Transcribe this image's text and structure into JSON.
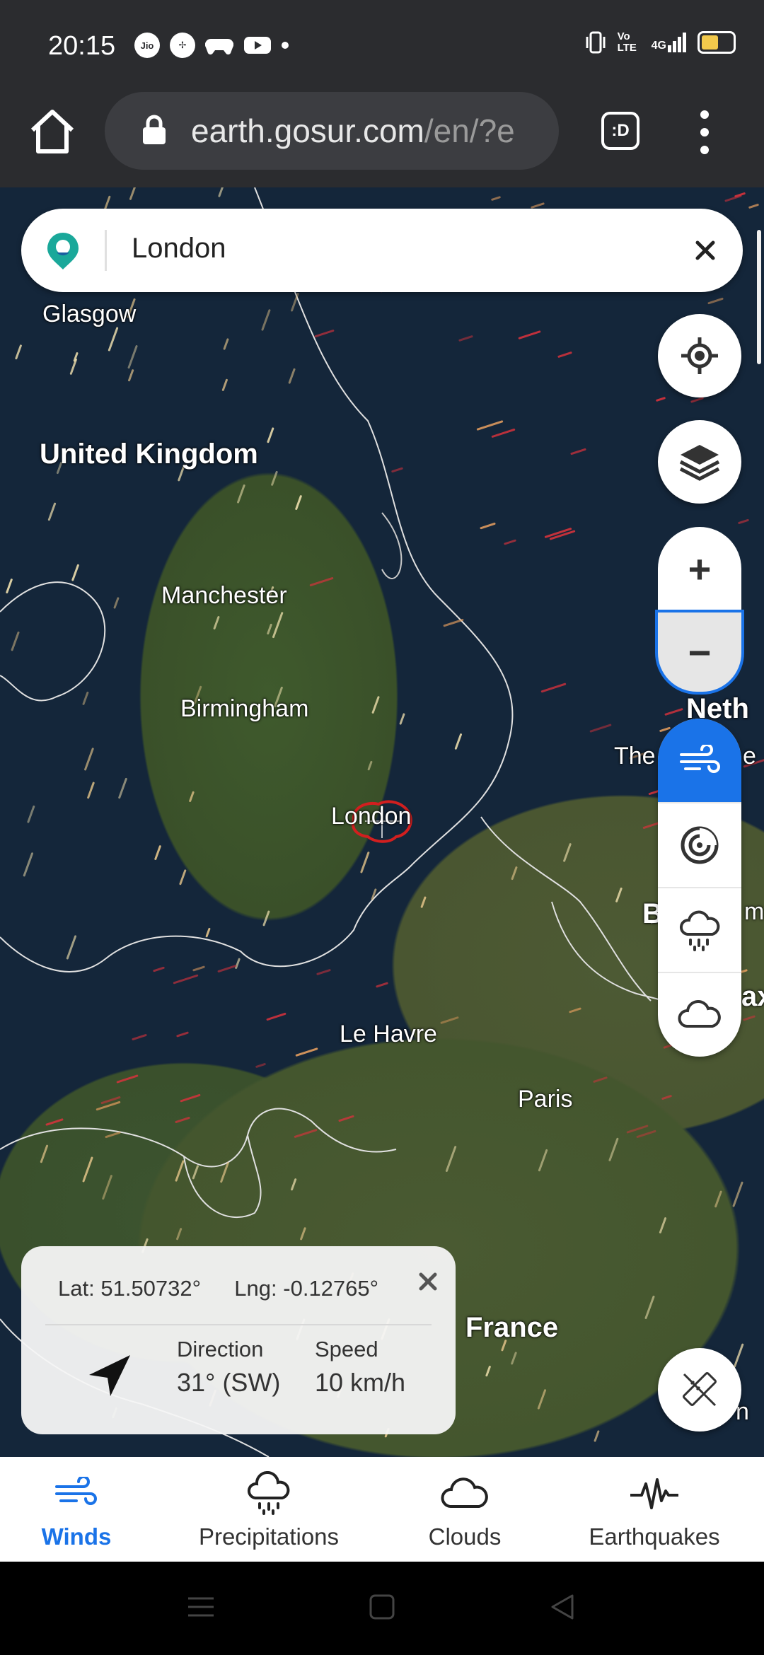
{
  "status_bar": {
    "time": "20:15",
    "left_icons": [
      "jio-icon",
      "fan-icon",
      "gamepad-icon",
      "youtube-icon",
      "dot-icon"
    ],
    "right_icons": [
      "vibrate-icon",
      "volte-icon",
      "signal-4g-icon",
      "battery-icon"
    ],
    "volte_text": "Vo LTE",
    "network_text": "4G",
    "battery_level": 0.55,
    "battery_color": "#f2c94c"
  },
  "browser": {
    "url_main": "earth.gosur.com",
    "url_rest": "/en/?e",
    "tabs_label": ":D"
  },
  "search": {
    "value": "London"
  },
  "map": {
    "labels": {
      "glasgow": "Glasgow",
      "united_kingdom": "United Kingdom",
      "manchester": "Manchester",
      "birmingham": "Birmingham",
      "london": "London",
      "le_havre": "Le Havre",
      "paris": "Paris",
      "france": "France",
      "neth": "Neth",
      "the_e": "The",
      "e_suffix": "e",
      "b_partial": "B",
      "m_partial": "m",
      "ax_partial": "ax",
      "n_partial": "n"
    }
  },
  "controls": {
    "zoom_in": "+",
    "zoom_out": "−"
  },
  "info_card": {
    "lat_label": "Lat:",
    "lat_value": "51.50732°",
    "lng_label": "Lng:",
    "lng_value": "-0.12765°",
    "direction_label": "Direction",
    "direction_value": "31° (SW)",
    "speed_label": "Speed",
    "speed_value": "10 km/h"
  },
  "bottom_nav": {
    "items": [
      {
        "label": "Winds",
        "active": true
      },
      {
        "label": "Precipitations",
        "active": false
      },
      {
        "label": "Clouds",
        "active": false
      },
      {
        "label": "Earthquakes",
        "active": false
      }
    ]
  },
  "colors": {
    "accent": "#1a73e8",
    "search_logo": "#1aa89a",
    "london_outline": "#d21f1f"
  }
}
